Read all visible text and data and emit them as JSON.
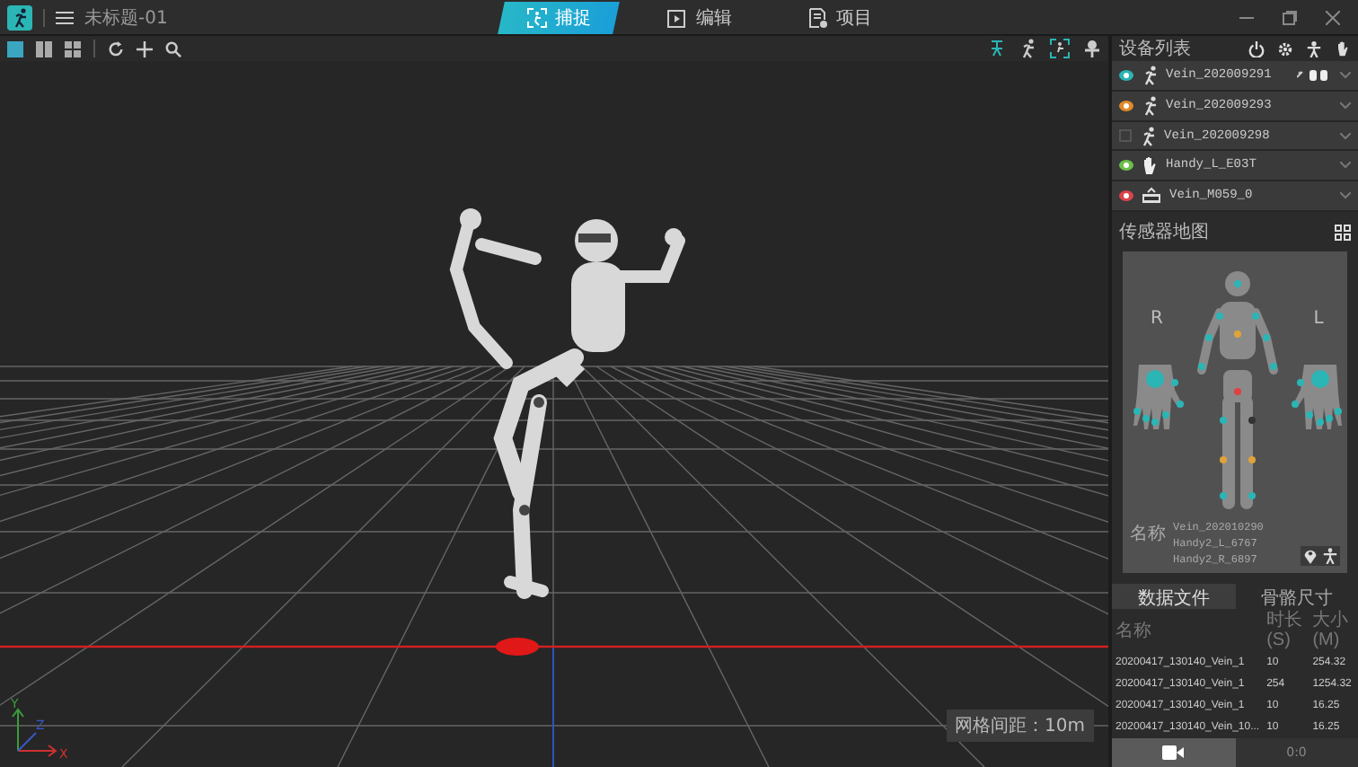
{
  "window": {
    "title": "未标题-01"
  },
  "mode_tabs": [
    {
      "label": "捕捉",
      "kind": "capture",
      "selected": true
    },
    {
      "label": "编辑",
      "kind": "edit",
      "selected": false
    },
    {
      "label": "项目",
      "kind": "project",
      "selected": false
    }
  ],
  "view_layouts": [
    {
      "kind": "single",
      "selected": true
    },
    {
      "kind": "double",
      "selected": false
    },
    {
      "kind": "quad",
      "selected": false
    }
  ],
  "viewport": {
    "grid_spacing": "网格间距：10m",
    "axis_labels": [
      "Y",
      "Z",
      "X"
    ]
  },
  "device_panel": {
    "title": "设备列表",
    "devices": [
      {
        "name": "Vein_202009291",
        "kind": "body",
        "visible": true,
        "color": "#2bb5b5",
        "linked": true
      },
      {
        "name": "Vein_202009293",
        "kind": "body",
        "visible": true,
        "color": "#e08a2a",
        "linked": false
      },
      {
        "name": "Vein_202009298",
        "kind": "body",
        "visible": false,
        "linked": false
      },
      {
        "name": "Handy_L_E03T",
        "kind": "hand",
        "visible": true,
        "color": "#6cc04a",
        "linked": false
      },
      {
        "name": "Vein_M059_0",
        "kind": "hub",
        "visible": true,
        "color": "#d9434b",
        "linked": false
      }
    ]
  },
  "sensor_map": {
    "title": "传感器地图",
    "right_side_label": "R",
    "left_side_label": "L",
    "name_label": "名称",
    "names": [
      "Vein_202010290",
      "Handy2_L_6767",
      "Handy2_R_6897"
    ]
  },
  "files": {
    "tabs": [
      {
        "label": "数据文件",
        "selected": true
      },
      {
        "label": "骨骼尺寸",
        "selected": false
      }
    ],
    "columns": [
      "名称",
      "时长(S)",
      "大小(M)"
    ],
    "rows": [
      [
        "20200417_130140_Vein_1",
        "10",
        "254.32"
      ],
      [
        "20200417_130140_Vein_1",
        "254",
        "1254.32"
      ],
      [
        "20200417_130140_Vein_1",
        "10",
        "16.25"
      ],
      [
        "20200417_130140_Vein_10...",
        "10",
        "16.25"
      ]
    ]
  },
  "bottom_tabs": [
    {
      "kind": "camera",
      "selected": true
    },
    {
      "kind": "text",
      "label": "0:0",
      "selected": false
    }
  ]
}
